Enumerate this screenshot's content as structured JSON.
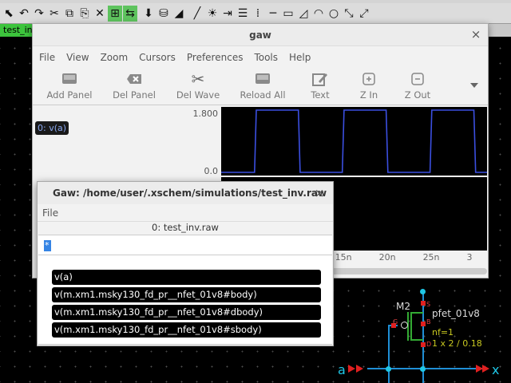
{
  "xschem": {
    "tab_label": "test_inv",
    "toolbar_icons": [
      "arrow-up-icon",
      "undo-icon",
      "redo-icon",
      "cut-icon",
      "copy-icon",
      "paste-icon",
      "delete-icon",
      "open-icon",
      "swap-icon",
      "save-icon",
      "netlist-icon",
      "simulate-icon",
      "waves-icon",
      "brightness-icon",
      "indent-icon",
      "list-icon",
      "line-icon",
      "rect-icon",
      "poly-icon",
      "arc-icon",
      "circle-icon",
      "zoom-fit-icon",
      "zoom-out-icon"
    ],
    "schematic": {
      "instance_name": "M2",
      "model": "pfet_01v8",
      "param_nf": "nf=1",
      "param_size": "1 x 2 / 0.18",
      "pin_s": "S",
      "pin_b": "B",
      "pin_g": "G",
      "pin_d": "D",
      "port_in": "a",
      "port_out": "x"
    }
  },
  "gaw": {
    "title": "gaw",
    "menu": [
      "File",
      "View",
      "Zoom",
      "Cursors",
      "Preferences",
      "Tools",
      "Help"
    ],
    "toolbar": [
      {
        "label": "Add Panel",
        "icon": "add-panel-icon"
      },
      {
        "label": "Del Panel",
        "icon": "del-panel-icon"
      },
      {
        "label": "Del Wave",
        "icon": "scissors-icon"
      },
      {
        "label": "Reload All",
        "icon": "reload-icon"
      },
      {
        "label": "Text",
        "icon": "text-edit-icon"
      },
      {
        "label": "Z In",
        "icon": "zoom-in-icon"
      },
      {
        "label": "Z Out",
        "icon": "zoom-out-icon"
      }
    ],
    "wave_button": "0: v(a)",
    "y_max": "1.800",
    "y_min": "0.0",
    "x_ticks": [
      "15n",
      "20n",
      "25n",
      "3"
    ],
    "wave_color": "#3b4fe0",
    "chart_data": {
      "type": "line",
      "series": [
        {
          "name": "0: v(a)",
          "x": [
            0,
            5,
            5.2,
            10,
            10.2,
            15,
            15.2,
            20,
            20.2,
            25,
            25.2,
            30,
            30.2,
            35
          ],
          "y": [
            0,
            0,
            1.8,
            1.8,
            0,
            0,
            1.8,
            1.8,
            0,
            0,
            1.8,
            1.8,
            0,
            0
          ]
        }
      ],
      "x_visible_range_ns": [
        1.2,
        31.5
      ],
      "ylim": [
        0,
        1.8
      ]
    }
  },
  "dialog": {
    "title": "Gaw: /home/user/.xschem/simulations/test_inv.raw",
    "menu_file": "File",
    "file_label": "0: test_inv.raw",
    "entry_value": "*",
    "signals": [
      "v(a)",
      "v(m.xm1.msky130_fd_pr__nfet_01v8#body)",
      "v(m.xm1.msky130_fd_pr__nfet_01v8#dbody)",
      "v(m.xm1.msky130_fd_pr__nfet_01v8#sbody)"
    ]
  }
}
